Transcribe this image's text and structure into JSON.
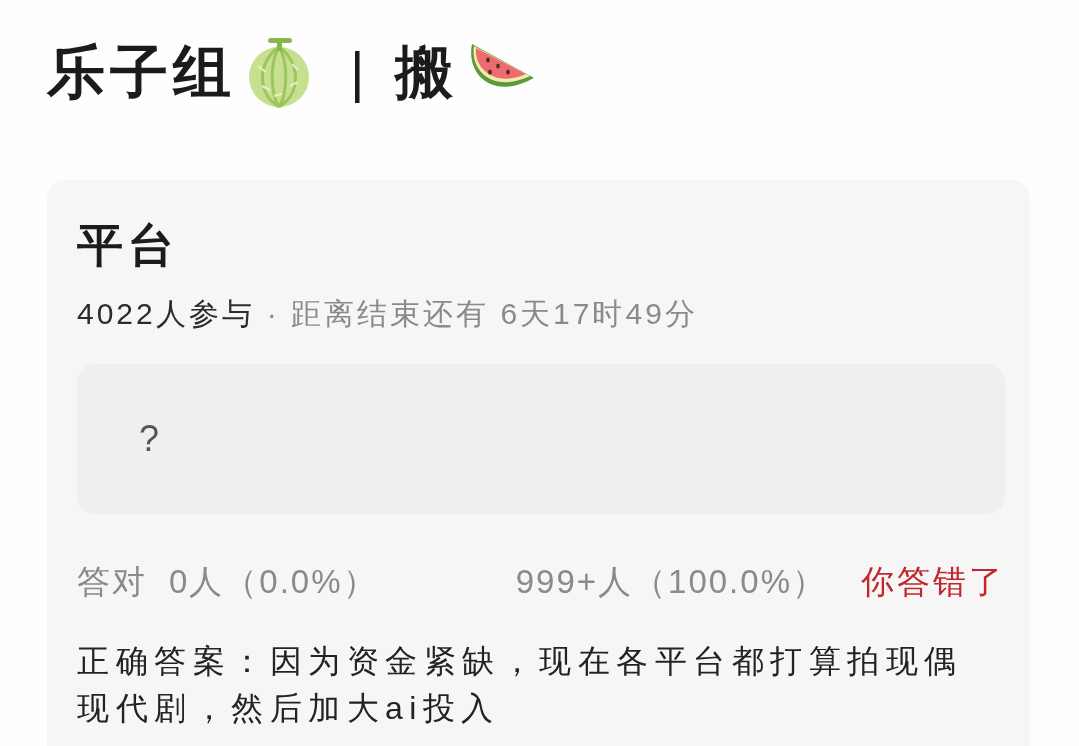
{
  "header": {
    "title": "乐子组",
    "separator": "|",
    "subtitle": "搬"
  },
  "quiz": {
    "title": "平台",
    "participants": "4022人参与",
    "countdown": "· 距离结束还有 6天17时49分",
    "answer_box": {
      "value": "?"
    },
    "stats": {
      "correct_label": "答对",
      "correct_count": "0人（0.0%）",
      "other_count": "999+人（100.0%）",
      "result": "你答错了",
      "user_correct": false
    },
    "correct_answer": "正确答案：因为资金紧缺，现在各平台都打算拍现偶现代剧，然后加大ai投入"
  }
}
